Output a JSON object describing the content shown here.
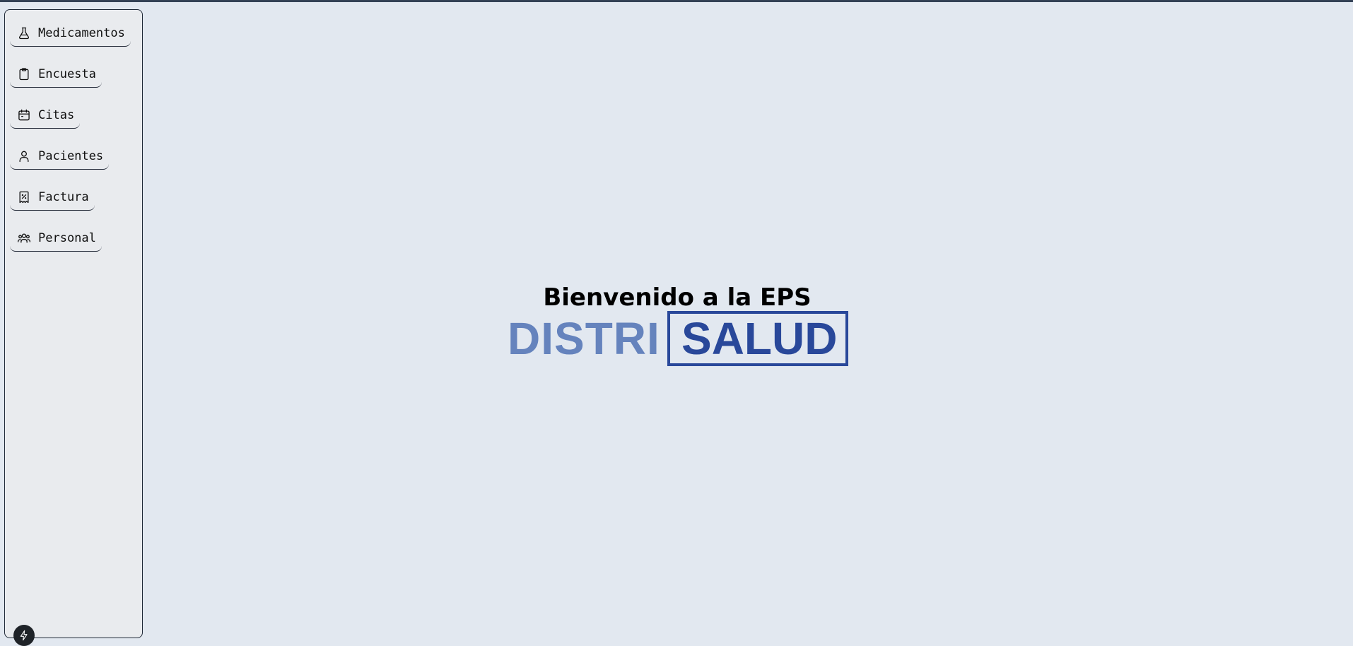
{
  "sidebar": {
    "items": [
      {
        "label": "Medicamentos",
        "icon": "flask-icon"
      },
      {
        "label": "Encuesta",
        "icon": "clipboard-icon"
      },
      {
        "label": "Citas",
        "icon": "calendar-icon"
      },
      {
        "label": "Pacientes",
        "icon": "user-icon"
      },
      {
        "label": "Factura",
        "icon": "receipt-percent-icon"
      },
      {
        "label": "Personal",
        "icon": "users-group-icon"
      }
    ],
    "footer_icon": "bolt-icon"
  },
  "main": {
    "welcome_title": "Bienvenido a la EPS",
    "logo": {
      "part1": "DISTRI",
      "part2": "SALUD",
      "part1_color": "#6583bd",
      "part2_color": "#29489a"
    }
  },
  "colors": {
    "background": "#e2e8f0",
    "sidebar_bg": "#e9ebee",
    "topbar": "#334155"
  }
}
